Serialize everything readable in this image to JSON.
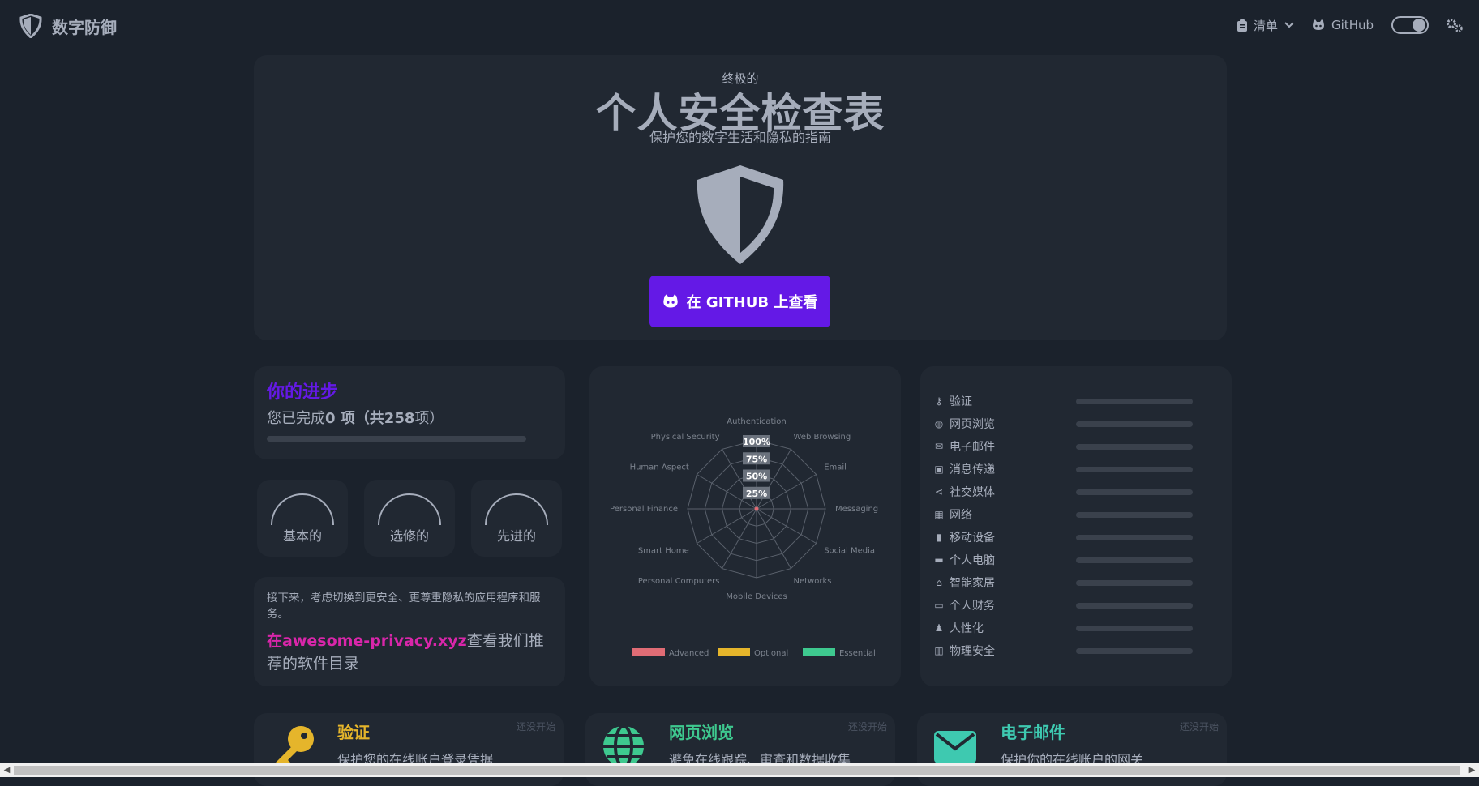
{
  "nav": {
    "brand": "数字防御",
    "checklist_label": "清单",
    "github_label": "GitHub"
  },
  "hero": {
    "eyebrow": "终极的",
    "title": "个人安全检查表",
    "subtitle": "保护您的数字生活和隐私的指南",
    "button_label": "在 GITHUB 上查看"
  },
  "progress": {
    "title": "你的进步",
    "line_prefix": "您已完成",
    "line_bold": "0 项（共258",
    "line_suffix": "项）",
    "completed_fraction": 0
  },
  "levels": [
    {
      "label": "基本的"
    },
    {
      "label": "选修的"
    },
    {
      "label": "先进的"
    }
  ],
  "tip": {
    "text": "接下来，考虑切换到更安全、更尊重隐私的应用程序和服务。",
    "link_text": "在awesome-privacy.xyz",
    "after_link": "查看我们推荐的软件目录"
  },
  "radar": {
    "axes": [
      "Authentication",
      "Web Browsing",
      "Email",
      "Messaging",
      "Social Media",
      "Networks",
      "Mobile Devices",
      "Personal Computers",
      "Smart Home",
      "Personal Finance",
      "Human Aspect",
      "Physical Security"
    ],
    "rings": [
      "100%",
      "75%",
      "50%",
      "25%"
    ],
    "legend": [
      {
        "label": "Advanced",
        "color": "#e06c75"
      },
      {
        "label": "Optional",
        "color": "#e5b52b"
      },
      {
        "label": "Essential",
        "color": "#3ec98f"
      }
    ]
  },
  "categories": [
    {
      "label": "验证",
      "icon": "key-icon"
    },
    {
      "label": "网页浏览",
      "icon": "globe-icon"
    },
    {
      "label": "电子邮件",
      "icon": "envelope-icon"
    },
    {
      "label": "消息传递",
      "icon": "chat-icon"
    },
    {
      "label": "社交媒体",
      "icon": "share-icon"
    },
    {
      "label": "网络",
      "icon": "network-icon"
    },
    {
      "label": "移动设备",
      "icon": "mobile-icon"
    },
    {
      "label": "个人电脑",
      "icon": "computer-icon"
    },
    {
      "label": "智能家居",
      "icon": "smart-home-icon"
    },
    {
      "label": "个人财务",
      "icon": "credit-card-icon"
    },
    {
      "label": "人性化",
      "icon": "person-icon"
    },
    {
      "label": "物理安全",
      "icon": "building-icon"
    }
  ],
  "sections": [
    {
      "title": "验证",
      "status": "还没开始",
      "desc": "保护您的在线账户登录凭据",
      "color": "#e5b52b",
      "icon": "key-icon"
    },
    {
      "title": "网页浏览",
      "status": "还没开始",
      "desc": "避免在线跟踪、审查和数据收集",
      "color": "#3ec98f",
      "icon": "globe-icon"
    },
    {
      "title": "电子邮件",
      "status": "还没开始",
      "desc": "保护你的在线账户的网关",
      "color": "#3ec9b0",
      "icon": "envelope-icon"
    }
  ]
}
